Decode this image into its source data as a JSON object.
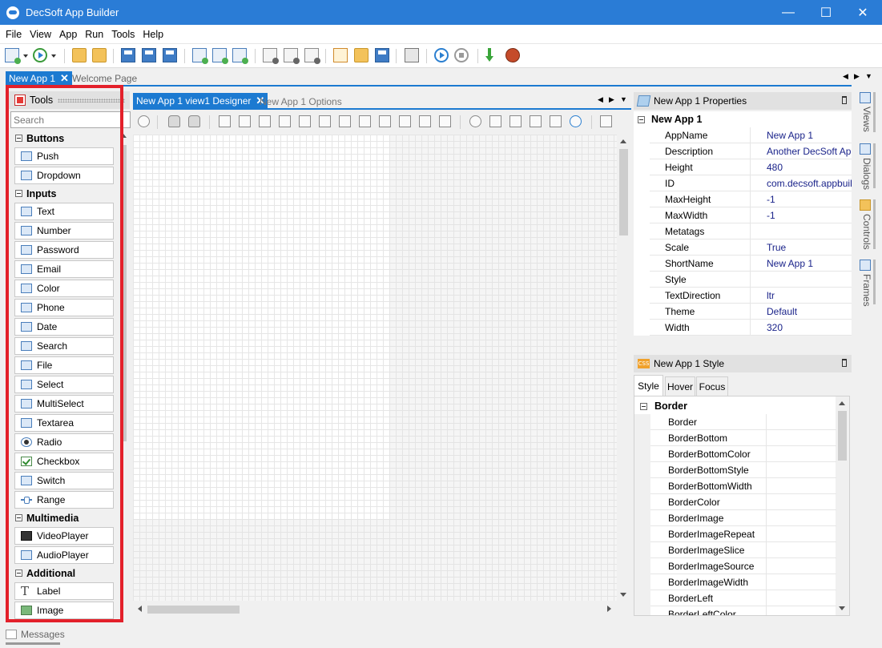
{
  "window": {
    "title": "DecSoft App Builder",
    "minimize": "—",
    "maximize": "☐",
    "close": "✕"
  },
  "menu": [
    "File",
    "View",
    "App",
    "Run",
    "Tools",
    "Help"
  ],
  "doc_tabs": {
    "active": "New App 1",
    "inactive": "Welcome Page",
    "close": "✕"
  },
  "tools_panel": {
    "title": "Tools",
    "search_placeholder": "Search",
    "categories": [
      {
        "name": "Buttons",
        "items": [
          "Push",
          "Dropdown"
        ]
      },
      {
        "name": "Inputs",
        "items": [
          "Text",
          "Number",
          "Password",
          "Email",
          "Color",
          "Phone",
          "Date",
          "Search",
          "File",
          "Select",
          "MultiSelect",
          "Textarea",
          "Radio",
          "Checkbox",
          "Switch",
          "Range"
        ]
      },
      {
        "name": "Multimedia",
        "items": [
          "VideoPlayer",
          "AudioPlayer"
        ]
      },
      {
        "name": "Additional",
        "items": [
          "Label",
          "Image"
        ]
      }
    ]
  },
  "designer": {
    "active_tab": "New App 1 view1 Designer",
    "inactive_tab": "New App 1 Options",
    "close": "✕"
  },
  "properties": {
    "title": "New App 1 Properties",
    "group": "New App 1",
    "rows": [
      {
        "key": "AppName",
        "value": "New App 1"
      },
      {
        "key": "Description",
        "value": "Another DecSoft App B"
      },
      {
        "key": "Height",
        "value": "480"
      },
      {
        "key": "ID",
        "value": "com.decsoft.appbuilde"
      },
      {
        "key": "MaxHeight",
        "value": "-1"
      },
      {
        "key": "MaxWidth",
        "value": "-1"
      },
      {
        "key": "Metatags",
        "value": ""
      },
      {
        "key": "Scale",
        "value": "True"
      },
      {
        "key": "ShortName",
        "value": "New App 1"
      },
      {
        "key": "Style",
        "value": ""
      },
      {
        "key": "TextDirection",
        "value": "ltr"
      },
      {
        "key": "Theme",
        "value": "Default"
      },
      {
        "key": "Width",
        "value": "320"
      }
    ]
  },
  "style_panel": {
    "title": "New App 1 Style",
    "tabs": [
      "Style",
      "Hover",
      "Focus"
    ],
    "group": "Border",
    "rows": [
      "Border",
      "BorderBottom",
      "BorderBottomColor",
      "BorderBottomStyle",
      "BorderBottomWidth",
      "BorderColor",
      "BorderImage",
      "BorderImageRepeat",
      "BorderImageSlice",
      "BorderImageSource",
      "BorderImageWidth",
      "BorderLeft",
      "BorderLeftColor"
    ]
  },
  "side_tabs": [
    "Views",
    "Dialogs",
    "Controls",
    "Frames"
  ],
  "bottom": {
    "messages": "Messages"
  },
  "colors": {
    "accent": "#1c7ad1",
    "titlebar": "#2a7cd6",
    "highlight": "#e3202a"
  }
}
